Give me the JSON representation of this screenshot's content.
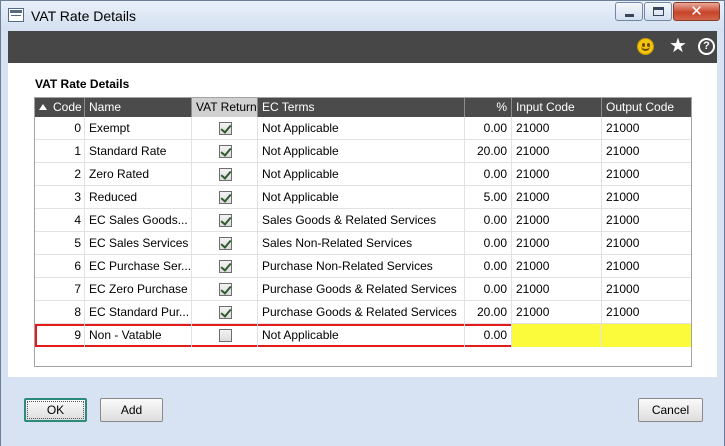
{
  "window": {
    "title": "VAT Rate Details",
    "close_glyph": "✕",
    "accent": "#474747"
  },
  "toolbar": {
    "icons": [
      "smiley-icon",
      "star-icon",
      "help-icon"
    ],
    "star_glyph": "★",
    "help_glyph": "?"
  },
  "section": {
    "title": "VAT Rate Details"
  },
  "grid": {
    "columns": {
      "code": "Code",
      "name": "Name",
      "vat_return": "VAT Return",
      "ec_terms": "EC Terms",
      "pct": "%",
      "input_code": "Input Code",
      "output_code": "Output Code"
    },
    "sorted_column": "vat_return",
    "rows": [
      {
        "code": "0",
        "name": "Exempt",
        "vat_return": true,
        "ec_terms": "Not Applicable",
        "pct": "0.00",
        "input_code": "21000",
        "output_code": "21000"
      },
      {
        "code": "1",
        "name": "Standard Rate",
        "vat_return": true,
        "ec_terms": "Not Applicable",
        "pct": "20.00",
        "input_code": "21000",
        "output_code": "21000"
      },
      {
        "code": "2",
        "name": "Zero Rated",
        "vat_return": true,
        "ec_terms": "Not Applicable",
        "pct": "0.00",
        "input_code": "21000",
        "output_code": "21000"
      },
      {
        "code": "3",
        "name": "Reduced",
        "vat_return": true,
        "ec_terms": "Not Applicable",
        "pct": "5.00",
        "input_code": "21000",
        "output_code": "21000"
      },
      {
        "code": "4",
        "name": "EC Sales Goods...",
        "vat_return": true,
        "ec_terms": "Sales Goods & Related Services",
        "pct": "0.00",
        "input_code": "21000",
        "output_code": "21000"
      },
      {
        "code": "5",
        "name": "EC Sales Services",
        "vat_return": true,
        "ec_terms": "Sales Non-Related Services",
        "pct": "0.00",
        "input_code": "21000",
        "output_code": "21000"
      },
      {
        "code": "6",
        "name": "EC Purchase Ser...",
        "vat_return": true,
        "ec_terms": "Purchase Non-Related Services",
        "pct": "0.00",
        "input_code": "21000",
        "output_code": "21000"
      },
      {
        "code": "7",
        "name": "EC Zero Purchase",
        "vat_return": true,
        "ec_terms": "Purchase Goods & Related Services",
        "pct": "0.00",
        "input_code": "21000",
        "output_code": "21000"
      },
      {
        "code": "8",
        "name": "EC Standard Pur...",
        "vat_return": true,
        "ec_terms": "Purchase Goods & Related Services",
        "pct": "20.00",
        "input_code": "21000",
        "output_code": "21000"
      },
      {
        "code": "9",
        "name": "Non - Vatable",
        "vat_return": false,
        "ec_terms": "Not Applicable",
        "pct": "0.00",
        "input_code": "",
        "output_code": "",
        "selected": true
      }
    ]
  },
  "footer": {
    "ok_label": "OK",
    "add_label": "Add",
    "cancel_label": "Cancel"
  }
}
